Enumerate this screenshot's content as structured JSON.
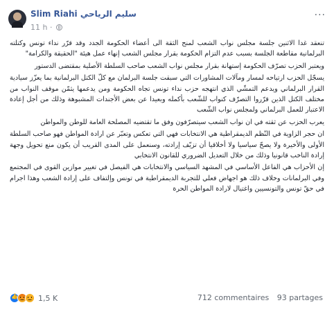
{
  "post": {
    "author_latin": "Slim Riahi",
    "author_arabic": "سليم الرياحي",
    "time": "11 h",
    "paragraphs": [
      "تنعقد غدا الاثنين جلسة مجلس نواب الشعب لمنح الثقة الى أعضاء الحكومة الجدد وقد قرّر نداء تونس وكتلته البرلمانية مقاطعة الجلسة بسبب عدم التزام الحكومة بقرار مجلس الشعب إنهاء عمل هيئة \"الحقيقة والكرامة\"",
      "ويعتبر الحزب تصرّف الحكومة إستهانة بقرار مجلس نواب الشعب صاحب السلطة الأصلية بمقتضى الدستور",
      "يسجّل الحزب ارتياحه لمسار ومآلات المشاورات التي سبقت جلسة البرلمان مع كلّ الكتل البرلمانية بما يعزّز سيادية القرار البرلماني ويدعم التمشّي الذي انتهجه حزب نداء تونس تجاه الحكومة ومن يدعمها يثمّن موقف النواب من مختلف الكتل الذين قرّروا التصرّف كنواب للشّعب بأكمله وبعيدا عن بعض الأجندات المشبوهة وذلك من أجل إعادة الاعتبار للعمل البرلماني ولمجلس نواب الشّعب",
      "يعرب الحزب عن ثقته في ان نواب الشعب سيتصرّفون وفق ما تقتضيه المصلحة العامة للوطن والمواطن",
      "ان حجر الزاوية في النّظم الديمقراطية هي الانتخابات فهي التي تعكس وتعبّر عن ارادة المواطن فهو صاحب السلطة الأولى والأخيرة ولا يصحّ سياسيا ولا أخلاقيا أن تزيّف إرادته، وسنعمل على المدى القريب أن يكون منع تحويل وجهة إرادة الناخب قانونيا وذلك من خلال التعديل الضروري للقانون الانتخابي",
      "إن الأحزاب هي الفاعل الأساسي في المشهد السياسي والانتخابات هي الفيصل في تغيير موازين القوى في المجتمع وفي البرلمانات وخلاف ذلك هو اجهاض فعلي للتجربة الديمقراطية في تونس وإلتفاف على إرادة الشعب وهذا اجرام في حقّ تونس والتونسيين واغتيال لارادة المواطن الحرة"
    ],
    "reactions_count": "1,5 K",
    "comments": "712 commentaires",
    "shares": "93 partages",
    "icons": {
      "privacy": "globe-icon",
      "menu": "more-icon",
      "reactions": [
        "like-icon",
        "angry-icon",
        "sad-icon"
      ]
    }
  }
}
